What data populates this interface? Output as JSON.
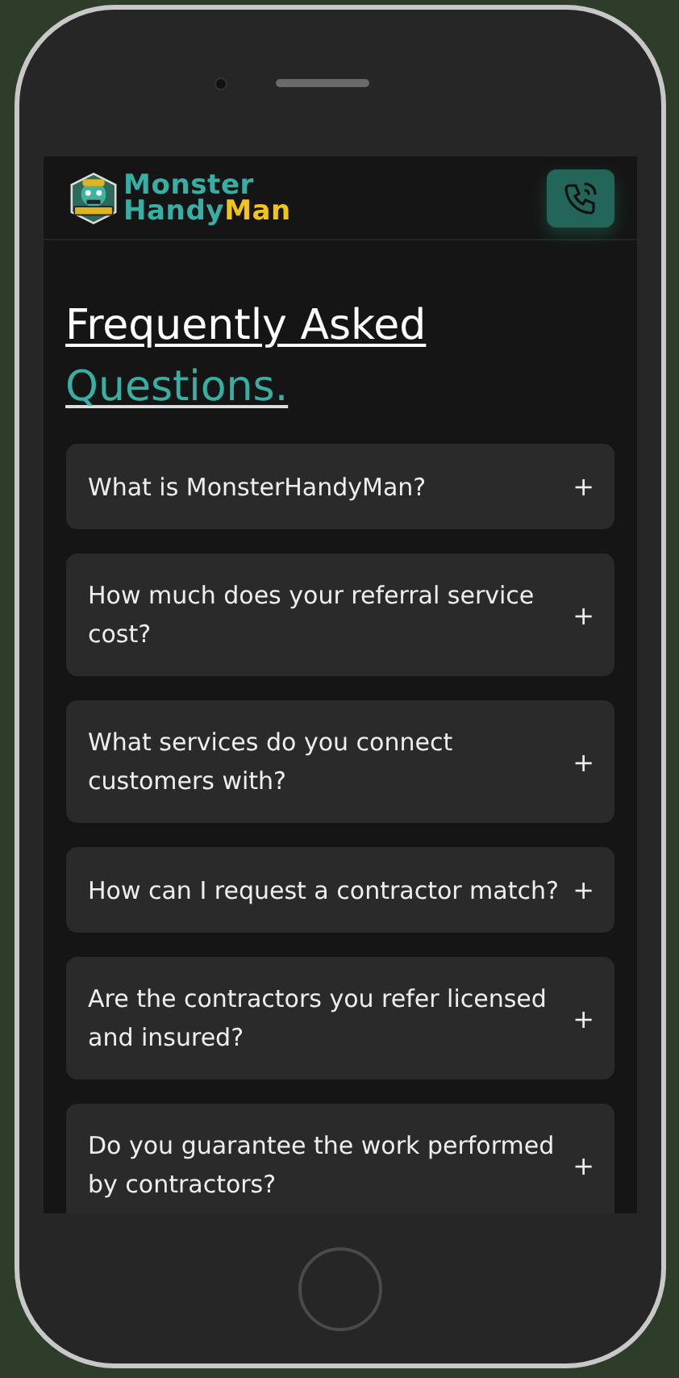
{
  "header": {
    "brand_first": "Monster",
    "brand_second": "Handy",
    "brand_third": "Man"
  },
  "title": {
    "line": "Frequently Asked",
    "highlight": "Questions."
  },
  "faq": [
    {
      "question": "What is MonsterHandyMan?",
      "toggle": "+"
    },
    {
      "question": "How much does your referral service cost?",
      "toggle": "+"
    },
    {
      "question": "What services do you connect customers with?",
      "toggle": "+"
    },
    {
      "question": "How can I request a contractor match?",
      "toggle": "+"
    },
    {
      "question": "Are the contractors you refer licensed and insured?",
      "toggle": "+"
    },
    {
      "question": "Do you guarantee the work performed by contractors?",
      "toggle": "+"
    }
  ]
}
